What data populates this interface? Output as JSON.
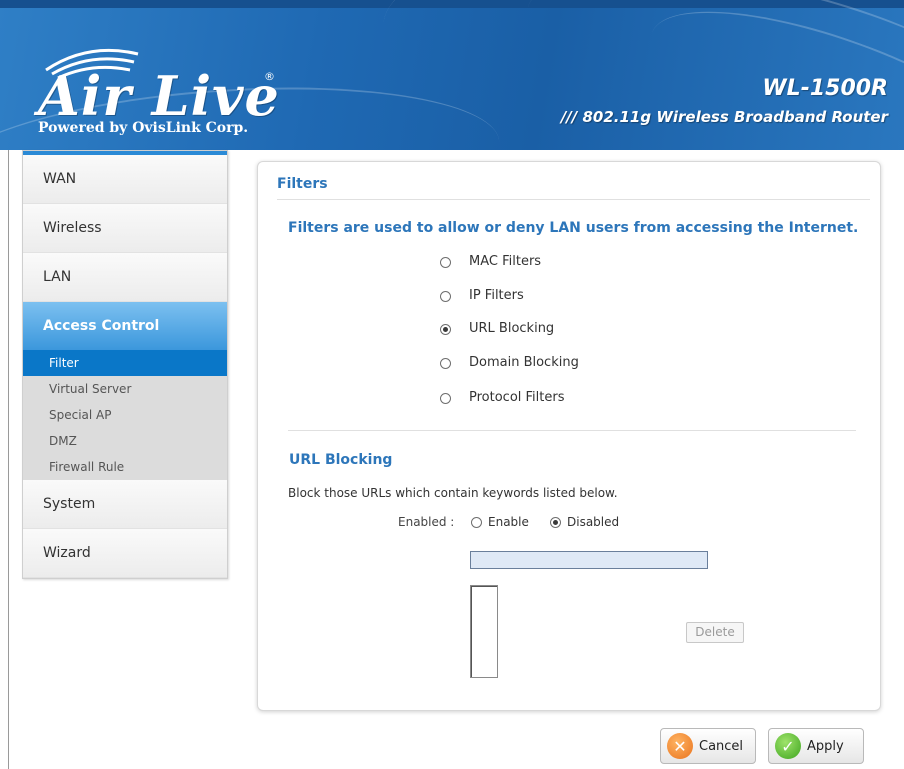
{
  "header": {
    "logo_text": "Air Live",
    "logo_reg": "®",
    "tagline": "Powered by OvisLink Corp.",
    "model": "WL-1500R",
    "subtitle": "/// 802.11g Wireless Broadband Router"
  },
  "sidebar": {
    "items": [
      {
        "label": "WAN"
      },
      {
        "label": "Wireless"
      },
      {
        "label": "LAN"
      },
      {
        "label": "Access Control"
      },
      {
        "label": "System"
      },
      {
        "label": "Wizard"
      }
    ],
    "subitems": [
      {
        "label": "Filter"
      },
      {
        "label": "Virtual Server"
      },
      {
        "label": "Special AP"
      },
      {
        "label": "DMZ"
      },
      {
        "label": "Firewall Rule"
      }
    ]
  },
  "main": {
    "title": "Filters",
    "intro": "Filters are used to allow or deny LAN users from accessing the Internet.",
    "filter_options": [
      {
        "label": "MAC Filters",
        "selected": false
      },
      {
        "label": "IP Filters",
        "selected": false
      },
      {
        "label": "URL Blocking",
        "selected": true
      },
      {
        "label": "Domain Blocking",
        "selected": false
      },
      {
        "label": "Protocol Filters",
        "selected": false
      }
    ],
    "section_title": "URL Blocking",
    "description": "Block those URLs which contain keywords listed below.",
    "enabled_label": "Enabled :",
    "enable_option": "Enable",
    "disabled_option": "Disabled",
    "enabled_state": "Disabled",
    "keyword_value": "",
    "delete_label": "Delete"
  },
  "buttons": {
    "cancel": "Cancel",
    "apply": "Apply"
  },
  "colors": {
    "header_blue": "#1f69b3",
    "accent_blue": "#2d76ba",
    "selected_blue": "#0a77c8"
  }
}
